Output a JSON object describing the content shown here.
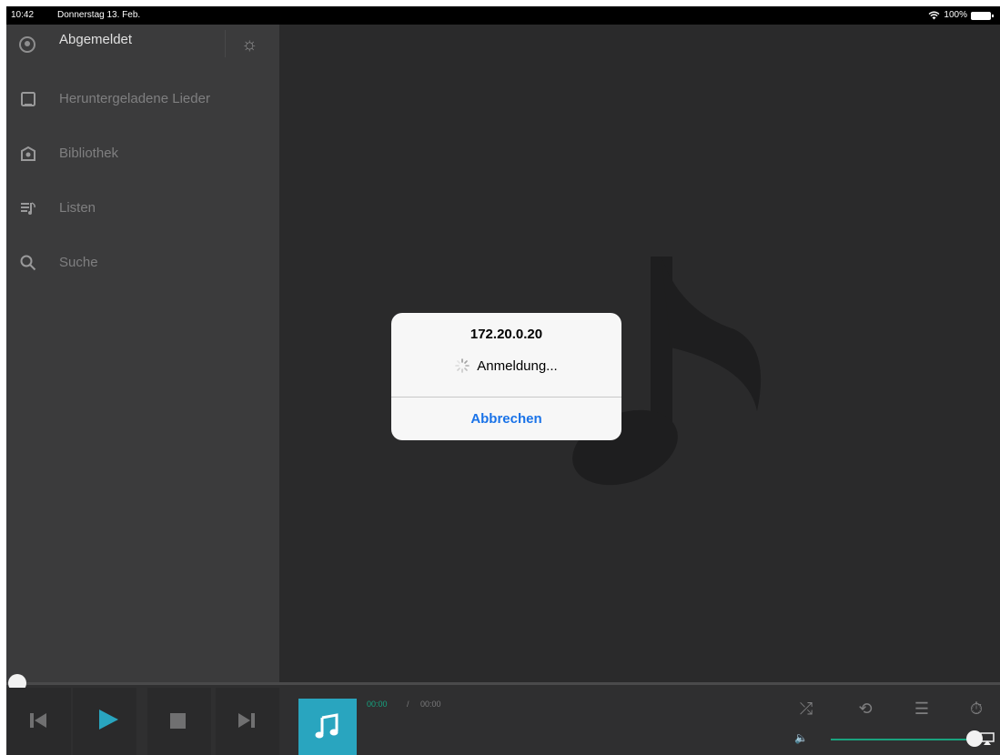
{
  "status_bar": {
    "time": "10:42",
    "date": "Donnerstag 13. Feb.",
    "battery": "100%"
  },
  "sidebar": {
    "account_label": "Abgemeldet",
    "items": [
      {
        "label": "Heruntergeladene Lieder",
        "icon": "tablet-icon"
      },
      {
        "label": "Bibliothek",
        "icon": "library-icon"
      },
      {
        "label": "Listen",
        "icon": "playlist-icon"
      },
      {
        "label": "Suche",
        "icon": "search-icon"
      }
    ]
  },
  "dialog": {
    "title": "172.20.0.20",
    "message": "Anmeldung...",
    "cancel_label": "Abbrechen"
  },
  "player": {
    "time_current": "00:00",
    "time_separator": "/",
    "time_total": "00:00",
    "progress": 0,
    "volume": 1.0
  },
  "colors": {
    "accent": "#29a5bf",
    "green": "#16a37f",
    "link_blue": "#1a73e8"
  }
}
